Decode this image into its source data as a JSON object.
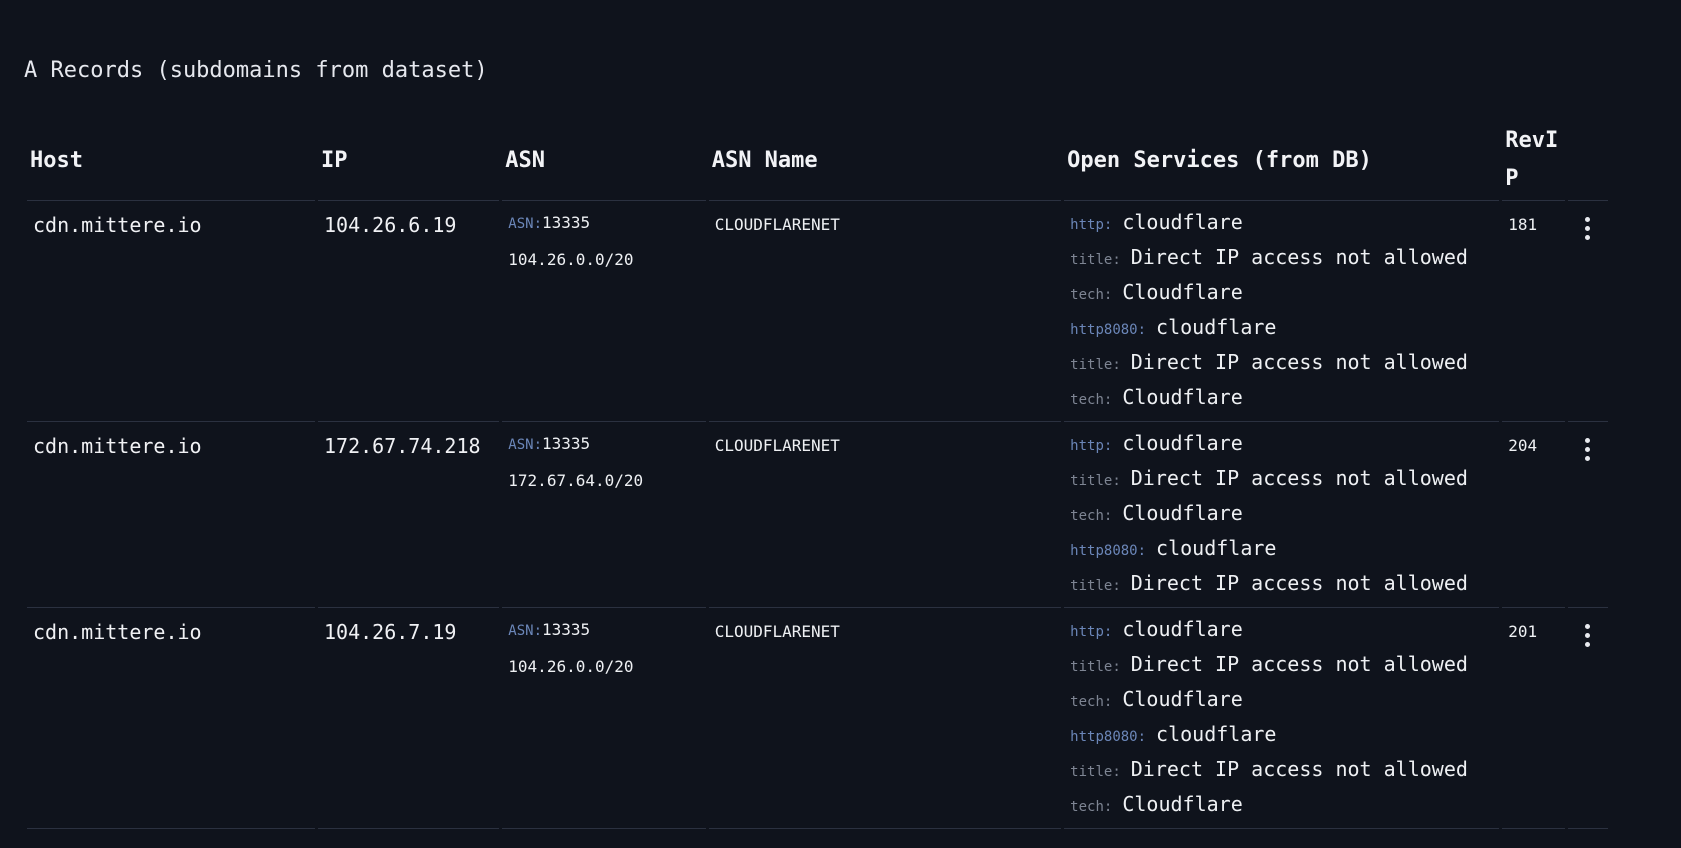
{
  "section": {
    "title": "A Records (subdomains from dataset)"
  },
  "table": {
    "headers": {
      "host": "Host",
      "ip": "IP",
      "asn": "ASN",
      "asn_name": "ASN Name",
      "services": "Open Services (from DB)",
      "revip": "RevIP"
    },
    "rows": [
      {
        "host": "cdn.mittere.io",
        "ip": "104.26.6.19",
        "asn_key": "ASN:",
        "asn": "13335",
        "cidr": "104.26.0.0/20",
        "asn_name": "CLOUDFLARENET",
        "services": [
          {
            "key": "http:",
            "value": "cloudflare"
          },
          {
            "key": "title:",
            "value": "Direct IP access not allowed"
          },
          {
            "key": "tech:",
            "value": "Cloudflare"
          },
          {
            "key": "http8080:",
            "value": "cloudflare"
          },
          {
            "key": "title:",
            "value": "Direct IP access not allowed"
          },
          {
            "key": "tech:",
            "value": "Cloudflare"
          }
        ],
        "revip": "181",
        "menu_icon": "more-vertical-icon"
      },
      {
        "host": "cdn.mittere.io",
        "ip": "172.67.74.218",
        "asn_key": "ASN:",
        "asn": "13335",
        "cidr": "172.67.64.0/20",
        "asn_name": "CLOUDFLARENET",
        "services": [
          {
            "key": "http:",
            "value": "cloudflare"
          },
          {
            "key": "title:",
            "value": "Direct IP access not allowed"
          },
          {
            "key": "tech:",
            "value": "Cloudflare"
          },
          {
            "key": "http8080:",
            "value": "cloudflare"
          },
          {
            "key": "title:",
            "value": "Direct IP access not allowed"
          }
        ],
        "revip": "204",
        "menu_icon": "more-vertical-icon"
      },
      {
        "host": "cdn.mittere.io",
        "ip": "104.26.7.19",
        "asn_key": "ASN:",
        "asn": "13335",
        "cidr": "104.26.0.0/20",
        "asn_name": "CLOUDFLARENET",
        "services": [
          {
            "key": "http:",
            "value": "cloudflare"
          },
          {
            "key": "title:",
            "value": "Direct IP access not allowed"
          },
          {
            "key": "tech:",
            "value": "Cloudflare"
          },
          {
            "key": "http8080:",
            "value": "cloudflare"
          },
          {
            "key": "title:",
            "value": "Direct IP access not allowed"
          },
          {
            "key": "tech:",
            "value": "Cloudflare"
          }
        ],
        "revip": "201",
        "menu_icon": "more-vertical-icon"
      }
    ]
  },
  "colors": {
    "background": "#0f131c",
    "text": "#eef0f3",
    "protocol_key": "#6b86b8",
    "muted_key": "#7e8593",
    "row_divider": "#2b3140"
  }
}
